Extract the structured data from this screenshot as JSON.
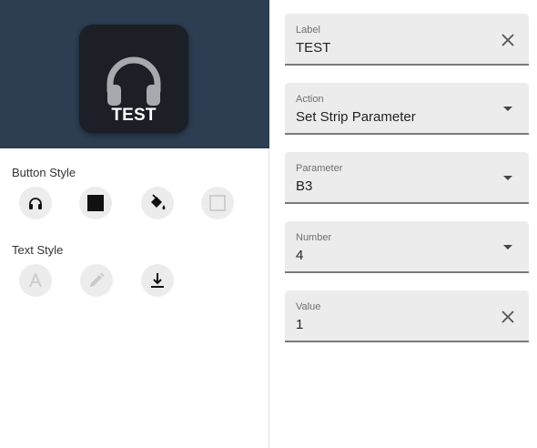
{
  "preview": {
    "button_label": "TEST",
    "icon": "headphones-icon",
    "background_color": "#2d3d52",
    "button_color": "#1c1f26"
  },
  "button_style": {
    "title": "Button Style",
    "tools": [
      {
        "name": "headphones-icon",
        "state": "enabled"
      },
      {
        "name": "square-fill-icon",
        "state": "enabled"
      },
      {
        "name": "paint-bucket-icon",
        "state": "enabled"
      },
      {
        "name": "empty-square-icon",
        "state": "disabled"
      }
    ]
  },
  "text_style": {
    "title": "Text Style",
    "tools": [
      {
        "name": "font-letter-icon",
        "state": "disabled"
      },
      {
        "name": "pencil-icon",
        "state": "disabled"
      },
      {
        "name": "align-bottom-icon",
        "state": "enabled"
      }
    ]
  },
  "fields": {
    "label": {
      "label": "Label",
      "value": "TEST",
      "action_icon": "clear-icon"
    },
    "action": {
      "label": "Action",
      "value": "Set Strip Parameter",
      "action_icon": "dropdown-arrow-icon"
    },
    "parameter": {
      "label": "Parameter",
      "value": "B3",
      "action_icon": "dropdown-arrow-icon"
    },
    "number": {
      "label": "Number",
      "value": "4",
      "action_icon": "dropdown-arrow-icon"
    },
    "value": {
      "label": "Value",
      "value": "1",
      "action_icon": "clear-icon"
    }
  }
}
